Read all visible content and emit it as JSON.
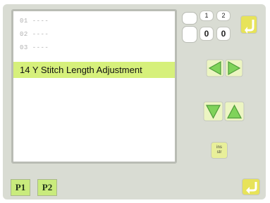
{
  "list": {
    "items": [
      {
        "label": "01 ----"
      },
      {
        "label": "02 ----"
      },
      {
        "label": "03 ----"
      }
    ],
    "selected_label": "14 Y Stitch Length Adjustment"
  },
  "counters": {
    "label_1": "1",
    "label_2": "2",
    "value_1": "0",
    "value_2": "0"
  },
  "buttons": {
    "small_tag": "ins\nstr"
  },
  "pages": {
    "p1": "P1",
    "p2": "P2"
  },
  "colors": {
    "selected_bg": "#d6f07b",
    "button_green": "#8fe06a",
    "panel_bg": "#d9dcd3",
    "accent_yellow": "#e7e35a"
  }
}
